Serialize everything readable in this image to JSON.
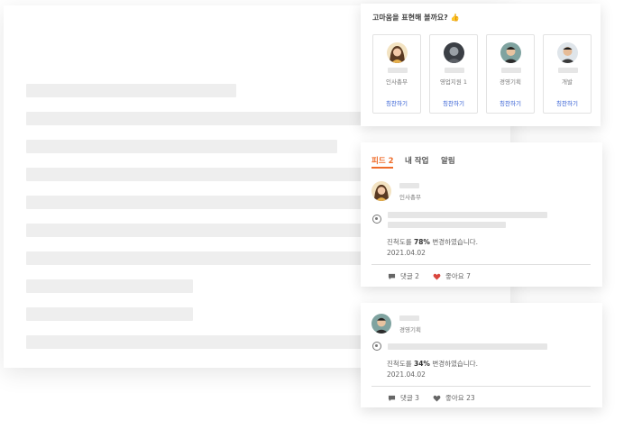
{
  "praise": {
    "title": "고마움을 표현해 볼까요? 👍",
    "people": [
      {
        "dept": "인사총무",
        "button": "칭찬하기"
      },
      {
        "dept": "영업지원 1",
        "button": "칭찬하기"
      },
      {
        "dept": "경영기획",
        "button": "칭찬하기"
      },
      {
        "dept": "개발",
        "button": "칭찬하기"
      }
    ]
  },
  "feed": {
    "tabs": [
      {
        "label": "피드 2",
        "active": true
      },
      {
        "label": "내 작업",
        "active": false
      },
      {
        "label": "알림",
        "active": false
      }
    ]
  },
  "posts": [
    {
      "dept": "인사총무",
      "message_prefix": "진척도를 ",
      "progress": "78%",
      "message_suffix": " 변경하였습니다.",
      "date": "2021.04.02",
      "comments": "댓글 2",
      "likes": "좋아요 7",
      "liked": true
    },
    {
      "dept": "경영기획",
      "message_prefix": "진척도를 ",
      "progress": "34%",
      "message_suffix": " 변경하였습니다.",
      "date": "2021.04.02",
      "comments": "댓글 3",
      "likes": "좋아요 23",
      "liked": false
    }
  ],
  "colors": {
    "accent": "#ef6c2a",
    "link": "#2f5bd3",
    "like": "#d9463e",
    "skeleton": "#eeeeee"
  },
  "icons": [
    "thumbs-up-icon",
    "comment-icon",
    "heart-icon",
    "radio-icon",
    "avatar"
  ]
}
